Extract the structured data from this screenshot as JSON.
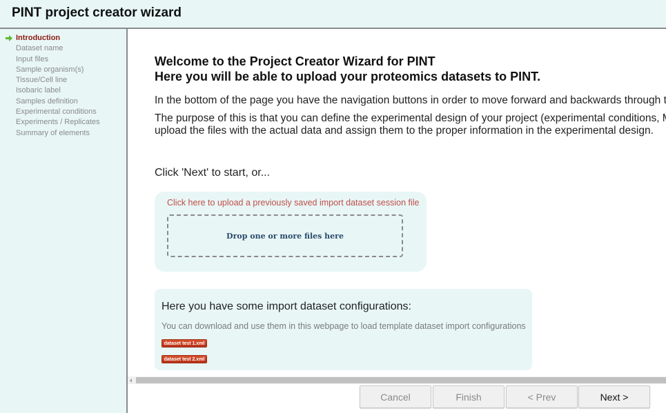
{
  "header": {
    "title": "PINT project creator wizard"
  },
  "sidebar": {
    "items": [
      {
        "label": "Introduction",
        "active": true
      },
      {
        "label": "Dataset name"
      },
      {
        "label": "Input files"
      },
      {
        "label": "Sample organism(s)"
      },
      {
        "label": "Tissue/Cell line"
      },
      {
        "label": "Isobaric label"
      },
      {
        "label": "Samples definition"
      },
      {
        "label": "Experimental conditions"
      },
      {
        "label": "Experiments / Replicates"
      },
      {
        "label": "Summary of elements"
      }
    ],
    "active_icon": "arrow-right-icon",
    "active_color": "#8b1a10",
    "icon_color": "#5cb82e"
  },
  "main": {
    "heading_line1": "Welcome to the Project Creator Wizard for PINT",
    "heading_line2": "Here you will be able to upload your proteomics datasets to PINT.",
    "para1": "In the bottom of the page you have the navigation buttons in order to move forward and backwards through t",
    "para2_line1": "The purpose of this is that you can define the experimental design of your project (experimental conditions, M",
    "para2_line2": "upload the files with the actual data and assign them to the proper information in the experimental design.",
    "start_prompt": "Click 'Next' to start, or...",
    "upload": {
      "link": "Click here to upload a previously saved import dataset session file",
      "dropzone": "Drop one or more files here"
    },
    "configs": {
      "title": "Here you have some import dataset configurations:",
      "description": "You can download and use them in this webpage to load template dataset import configurations",
      "files": [
        "dataset test 1.xml",
        "dataset test 2.xml"
      ]
    }
  },
  "navigation": {
    "cancel": "Cancel",
    "finish": "Finish",
    "prev": "< Prev",
    "next": "Next >"
  }
}
